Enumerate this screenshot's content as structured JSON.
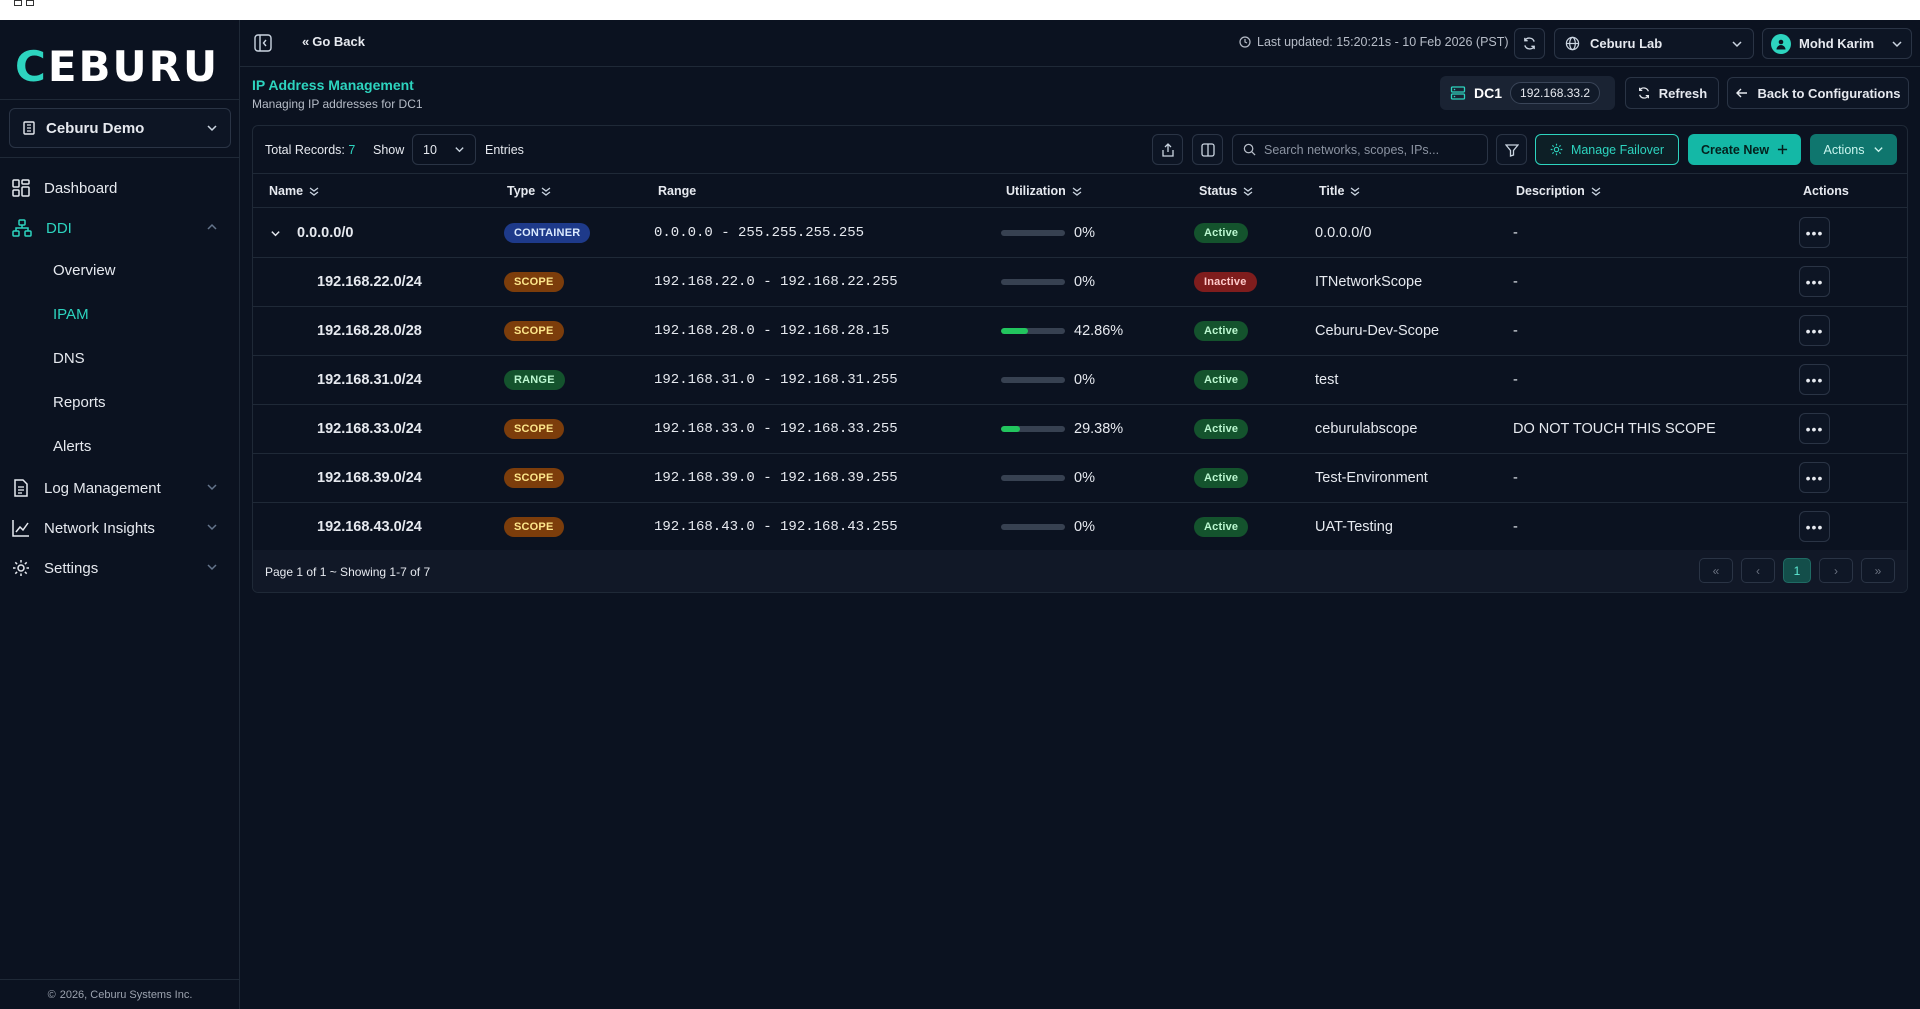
{
  "sidebar": {
    "logo_text_accent": "C",
    "logo_text_rest": "EBURU",
    "org_select": "Ceburu Demo",
    "nav": {
      "dashboard": "Dashboard",
      "ddi": "DDI",
      "overview": "Overview",
      "ipam": "IPAM",
      "dns": "DNS",
      "reports": "Reports",
      "alerts": "Alerts",
      "log_management": "Log Management",
      "network_insights": "Network Insights",
      "settings": "Settings"
    },
    "footer": "2026, Ceburu Systems Inc."
  },
  "header": {
    "go_back": "Go Back",
    "last_updated": "Last updated: 15:20:21s - 10 Feb 2026 (PST)",
    "lab_select": "Ceburu Lab",
    "user_name": "Mohd Karim"
  },
  "page": {
    "title": "IP Address Management",
    "subtitle": "Managing IP addresses for DC1",
    "dc_label": "DC1",
    "dc_ip": "192.168.33.2",
    "refresh_label": "Refresh",
    "back_label": "Back to Configurations"
  },
  "toolbar": {
    "total_label": "Total Records:",
    "total_value": "7",
    "show_label": "Show",
    "show_value": "10",
    "entries_label": "Entries",
    "search_placeholder": "Search networks, scopes, IPs...",
    "manage_failover": "Manage Failover",
    "create_new": "Create New",
    "actions": "Actions"
  },
  "table": {
    "headers": {
      "name": "Name",
      "type": "Type",
      "range": "Range",
      "utilization": "Utilization",
      "status": "Status",
      "title": "Title",
      "description": "Description",
      "actions": "Actions"
    },
    "rows": [
      {
        "name": "0.0.0.0/0",
        "type": "CONTAINER",
        "range": "0.0.0.0 - 255.255.255.255",
        "util": "0%",
        "util_value": 0,
        "status": "Active",
        "title": "0.0.0.0/0",
        "description": "-"
      },
      {
        "name": "192.168.22.0/24",
        "type": "SCOPE",
        "range": "192.168.22.0 - 192.168.22.255",
        "util": "0%",
        "util_value": 0,
        "status": "Inactive",
        "title": "ITNetworkScope",
        "description": "-"
      },
      {
        "name": "192.168.28.0/28",
        "type": "SCOPE",
        "range": "192.168.28.0 - 192.168.28.15",
        "util": "42.86%",
        "util_value": 42.86,
        "status": "Active",
        "title": "Ceburu-Dev-Scope",
        "description": "-"
      },
      {
        "name": "192.168.31.0/24",
        "type": "RANGE",
        "range": "192.168.31.0 - 192.168.31.255",
        "util": "0%",
        "util_value": 0,
        "status": "Active",
        "title": "test",
        "description": "-"
      },
      {
        "name": "192.168.33.0/24",
        "type": "SCOPE",
        "range": "192.168.33.0 - 192.168.33.255",
        "util": "29.38%",
        "util_value": 29.38,
        "status": "Active",
        "title": "ceburulabscope",
        "description": "DO NOT TOUCH THIS SCOPE"
      },
      {
        "name": "192.168.39.0/24",
        "type": "SCOPE",
        "range": "192.168.39.0 - 192.168.39.255",
        "util": "0%",
        "util_value": 0,
        "status": "Active",
        "title": "Test-Environment",
        "description": "-"
      },
      {
        "name": "192.168.43.0/24",
        "type": "SCOPE",
        "range": "192.168.43.0 - 192.168.43.255",
        "util": "0%",
        "util_value": 0,
        "status": "Active",
        "title": "UAT-Testing",
        "description": "-"
      }
    ],
    "footer_info": "Page 1 of 1 ~ Showing 1-7 of 7",
    "current_page": "1"
  },
  "colors": {
    "accent": "#2dd4bf",
    "background": "#0b1220",
    "util_fill": "#22c55e"
  }
}
